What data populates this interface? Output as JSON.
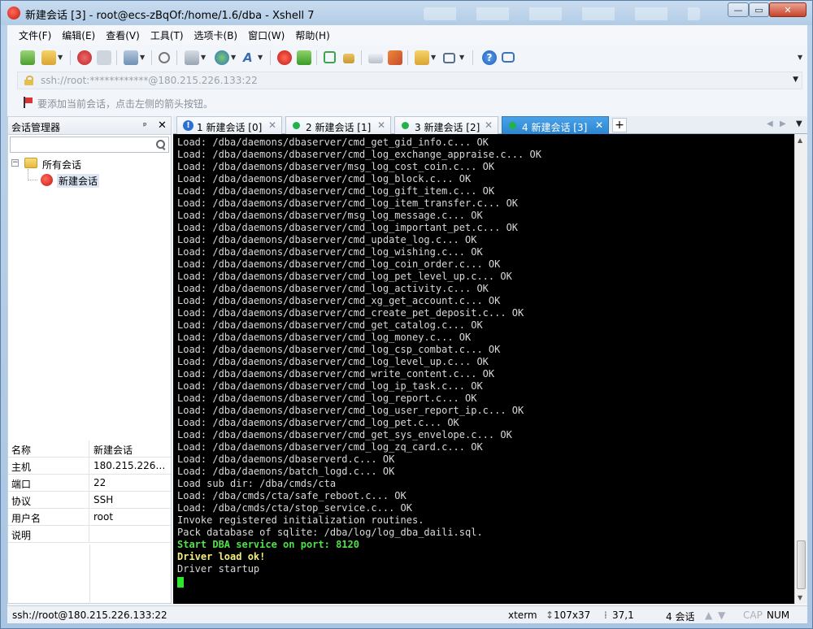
{
  "window": {
    "title": "新建会话 [3] - root@ecs-zBqOf:/home/1.6/dba - Xshell 7",
    "controls": {
      "minimize": "—",
      "maximize": "▭",
      "close": "✕"
    }
  },
  "menu": [
    "文件(F)",
    "编辑(E)",
    "查看(V)",
    "工具(T)",
    "选项卡(B)",
    "窗口(W)",
    "帮助(H)"
  ],
  "address_bar": {
    "text": "ssh://root:************@180.215.226.133:22"
  },
  "info_bar": {
    "text": "要添加当前会话，点击左侧的箭头按钮。"
  },
  "session_manager": {
    "title": "会话管理器",
    "pin": "ᵖ",
    "close": "✕",
    "tree": {
      "root_label": "所有会话",
      "toggle": "−",
      "child_label": "新建会话"
    },
    "properties": [
      {
        "key": "名称",
        "value": "新建会话"
      },
      {
        "key": "主机",
        "value": "180.215.226.1..."
      },
      {
        "key": "端口",
        "value": "22"
      },
      {
        "key": "协议",
        "value": "SSH"
      },
      {
        "key": "用户名",
        "value": "root"
      },
      {
        "key": "说明",
        "value": ""
      }
    ]
  },
  "tabs": [
    {
      "label": "1 新建会话 [0]",
      "status": "warning",
      "active": false
    },
    {
      "label": "2 新建会话 [1]",
      "status": "connected",
      "active": false
    },
    {
      "label": "3 新建会话 [2]",
      "status": "connected",
      "active": false
    },
    {
      "label": "4 新建会话 [3]",
      "status": "connected",
      "active": true
    }
  ],
  "tab_add": "+",
  "terminal": {
    "lines": [
      {
        "text": "Load: /dba/daemons/dbaserver/cmd_get_gid_info.c... OK",
        "style": "normal"
      },
      {
        "text": "Load: /dba/daemons/dbaserver/cmd_log_exchange_appraise.c... OK",
        "style": "normal"
      },
      {
        "text": "Load: /dba/daemons/dbaserver/msg_log_cost_coin.c... OK",
        "style": "normal"
      },
      {
        "text": "Load: /dba/daemons/dbaserver/cmd_log_block.c... OK",
        "style": "normal"
      },
      {
        "text": "Load: /dba/daemons/dbaserver/cmd_log_gift_item.c... OK",
        "style": "normal"
      },
      {
        "text": "Load: /dba/daemons/dbaserver/cmd_log_item_transfer.c... OK",
        "style": "normal"
      },
      {
        "text": "Load: /dba/daemons/dbaserver/msg_log_message.c... OK",
        "style": "normal"
      },
      {
        "text": "Load: /dba/daemons/dbaserver/cmd_log_important_pet.c... OK",
        "style": "normal"
      },
      {
        "text": "Load: /dba/daemons/dbaserver/cmd_update_log.c... OK",
        "style": "normal"
      },
      {
        "text": "Load: /dba/daemons/dbaserver/cmd_log_wishing.c... OK",
        "style": "normal"
      },
      {
        "text": "Load: /dba/daemons/dbaserver/cmd_log_coin_order.c... OK",
        "style": "normal"
      },
      {
        "text": "Load: /dba/daemons/dbaserver/cmd_log_pet_level_up.c... OK",
        "style": "normal"
      },
      {
        "text": "Load: /dba/daemons/dbaserver/cmd_log_activity.c... OK",
        "style": "normal"
      },
      {
        "text": "Load: /dba/daemons/dbaserver/cmd_xg_get_account.c... OK",
        "style": "normal"
      },
      {
        "text": "Load: /dba/daemons/dbaserver/cmd_create_pet_deposit.c... OK",
        "style": "normal"
      },
      {
        "text": "Load: /dba/daemons/dbaserver/cmd_get_catalog.c... OK",
        "style": "normal"
      },
      {
        "text": "Load: /dba/daemons/dbaserver/cmd_log_money.c... OK",
        "style": "normal"
      },
      {
        "text": "Load: /dba/daemons/dbaserver/cmd_log_csp_combat.c... OK",
        "style": "normal"
      },
      {
        "text": "Load: /dba/daemons/dbaserver/cmd_log_level_up.c... OK",
        "style": "normal"
      },
      {
        "text": "Load: /dba/daemons/dbaserver/cmd_write_content.c... OK",
        "style": "normal"
      },
      {
        "text": "Load: /dba/daemons/dbaserver/cmd_log_ip_task.c... OK",
        "style": "normal"
      },
      {
        "text": "Load: /dba/daemons/dbaserver/cmd_log_report.c... OK",
        "style": "normal"
      },
      {
        "text": "Load: /dba/daemons/dbaserver/cmd_log_user_report_ip.c... OK",
        "style": "normal"
      },
      {
        "text": "Load: /dba/daemons/dbaserver/cmd_log_pet.c... OK",
        "style": "normal"
      },
      {
        "text": "Load: /dba/daemons/dbaserver/cmd_get_sys_envelope.c... OK",
        "style": "normal"
      },
      {
        "text": "Load: /dba/daemons/dbaserver/cmd_log_zq_card.c... OK",
        "style": "normal"
      },
      {
        "text": "Load: /dba/daemons/dbaserverd.c... OK",
        "style": "normal"
      },
      {
        "text": "Load: /dba/daemons/batch_logd.c... OK",
        "style": "normal"
      },
      {
        "text": "Load sub dir: /dba/cmds/cta",
        "style": "normal"
      },
      {
        "text": "Load: /dba/cmds/cta/safe_reboot.c... OK",
        "style": "normal"
      },
      {
        "text": "Load: /dba/cmds/cta/stop_service.c... OK",
        "style": "normal"
      },
      {
        "text": "Invoke registered initialization routines.",
        "style": "normal"
      },
      {
        "text": "Pack database of sqlite: /dba/log/log_dba_daili.sql.",
        "style": "normal"
      },
      {
        "text": "Start DBA service on port: 8120",
        "style": "green"
      },
      {
        "text": "Driver load ok!",
        "style": "yellow"
      },
      {
        "text": "Driver startup",
        "style": "normal"
      }
    ]
  },
  "status_bar": {
    "connection": "ssh://root@180.215.226.133:22",
    "term_type": "xterm",
    "size": "107x37",
    "cursor_pos": "37,1",
    "sessions": "4 会话",
    "caps": "CAP",
    "num": "NUM"
  },
  "colors": {
    "terminal_bg": "#000000",
    "terminal_fg": "#d9d9d9",
    "highlight_green": "#4ee34a",
    "highlight_yellow": "#f2ee7a",
    "active_tab": "#2b85d0",
    "connected_dot": "#21b34a"
  }
}
